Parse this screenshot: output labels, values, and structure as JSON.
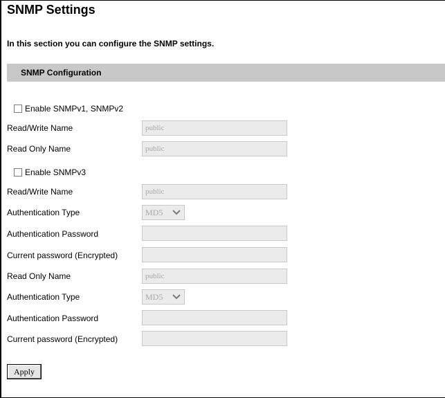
{
  "page": {
    "title": "SNMP Settings",
    "intro": "In this section you can configure the SNMP settings."
  },
  "section": {
    "title": "SNMP Configuration"
  },
  "v1v2": {
    "checkbox_label": "Enable SNMPv1, SNMPv2",
    "checked": false,
    "rw_name_label": "Read/Write Name",
    "rw_name_value": "public",
    "ro_name_label": "Read Only Name",
    "ro_name_value": "public"
  },
  "v3": {
    "checkbox_label": "Enable SNMPv3",
    "checked": false,
    "rw": {
      "name_label": "Read/Write Name",
      "name_value": "public",
      "auth_type_label": "Authentication Type",
      "auth_type_value": "MD5",
      "auth_password_label": "Authentication Password",
      "auth_password_value": "",
      "current_password_label": "Current password (Encrypted)",
      "current_password_value": ""
    },
    "ro": {
      "name_label": "Read Only Name",
      "name_value": "public",
      "auth_type_label": "Authentication Type",
      "auth_type_value": "MD5",
      "auth_password_label": "Authentication Password",
      "auth_password_value": "",
      "current_password_label": "Current password (Encrypted)",
      "current_password_value": ""
    }
  },
  "actions": {
    "apply_label": "Apply"
  },
  "colors": {
    "section_bar": "#c8c8c8",
    "disabled_field_bg": "#ebebeb",
    "disabled_text": "#a8a8a8"
  },
  "icons": {
    "dropdown": "chevron-down-icon"
  }
}
